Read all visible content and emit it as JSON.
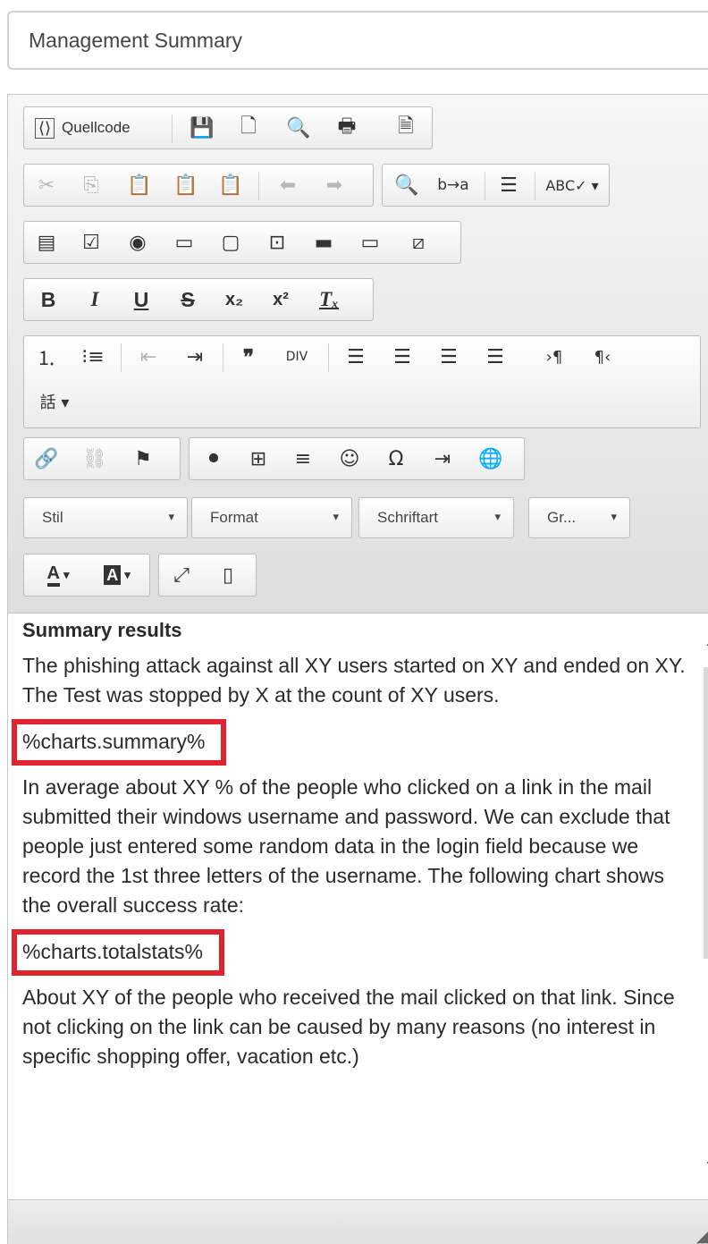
{
  "title_field": {
    "value": "Management Summary"
  },
  "toolbar": {
    "source_label": "Quellcode",
    "bold": "B",
    "italic": "I",
    "underline": "U",
    "strike": "S",
    "combos": {
      "style": "Stil",
      "format": "Format",
      "font": "Schriftart",
      "size": "Gr..."
    },
    "text_color": "A",
    "bg_color": "A"
  },
  "content": {
    "heading": "Summary results",
    "para1": "The phishing attack against all XY users started on XY and ended on XY. The Test was stopped by X at the count of XY users.",
    "placeholder1": "%charts.summary%",
    "para2": "In average about XY % of the people who clicked on a link in the mail submitted their windows username and password. We can exclude that people just entered some random data in the login field because we record the 1st three letters of the username. The following chart shows the overall success rate:",
    "placeholder2": "%charts.totalstats%",
    "para3": "About XY of the people who received the mail clicked on that link. Since not clicking on the link can be caused by many reasons (no interest in specific shopping offer, vacation etc.)"
  },
  "colors": {
    "highlight_border": "#e0232f"
  }
}
